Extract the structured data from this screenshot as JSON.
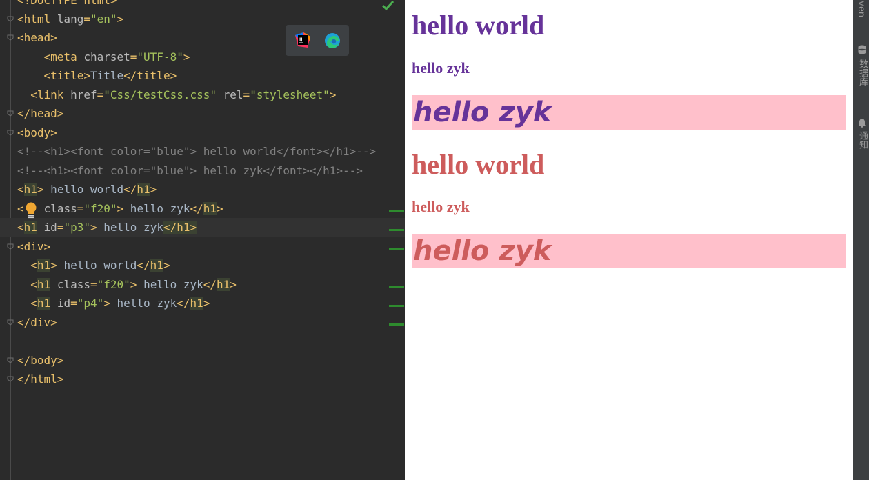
{
  "editor": {
    "lines": [
      [
        [
          "t-tag",
          "<!DOCTYPE html>"
        ]
      ],
      [
        [
          "t-tag",
          "<html "
        ],
        [
          "t-attr",
          "lang"
        ],
        [
          "t-tag",
          "="
        ],
        [
          "t-val",
          "\"en\""
        ],
        [
          "t-tag",
          ">"
        ]
      ],
      [
        [
          "t-tag",
          "<head>"
        ]
      ],
      [
        [
          "t-text",
          "    "
        ],
        [
          "t-tag",
          "<meta "
        ],
        [
          "t-attr",
          "charset"
        ],
        [
          "t-tag",
          "="
        ],
        [
          "t-val",
          "\"UTF-8\""
        ],
        [
          "t-tag",
          ">"
        ]
      ],
      [
        [
          "t-text",
          "    "
        ],
        [
          "t-tag",
          "<title>"
        ],
        [
          "t-text",
          "Title"
        ],
        [
          "t-tag",
          "</title>"
        ]
      ],
      [
        [
          "t-text",
          "  "
        ],
        [
          "t-tag",
          "<link "
        ],
        [
          "t-attr",
          "href"
        ],
        [
          "t-tag",
          "="
        ],
        [
          "t-val",
          "\"Css/testCss.css\""
        ],
        [
          "t-text",
          " "
        ],
        [
          "t-attr",
          "rel"
        ],
        [
          "t-tag",
          "="
        ],
        [
          "t-val",
          "\"stylesheet\""
        ],
        [
          "t-tag",
          ">"
        ]
      ],
      [
        [
          "t-tag",
          "</head>"
        ]
      ],
      [
        [
          "t-tag",
          "<body>"
        ]
      ],
      [
        [
          "t-cmt",
          "<!--<h1><font color=\"blue\"> hello world</font></h1>-->"
        ]
      ],
      [
        [
          "t-cmt",
          "<!--<h1><font color=\"blue\"> hello zyk</font></h1>-->"
        ]
      ],
      [
        [
          "t-tag",
          "<"
        ],
        [
          "t-tag t-hl",
          "h1"
        ],
        [
          "t-tag",
          ">"
        ],
        [
          "t-text",
          " hello world"
        ],
        [
          "t-tag",
          "</"
        ],
        [
          "t-tag t-hl",
          "h1"
        ],
        [
          "t-tag",
          ">"
        ]
      ],
      [
        [
          "t-tag",
          "<"
        ],
        [
          "t-text",
          "   "
        ],
        [
          "t-attr",
          "class"
        ],
        [
          "t-tag",
          "="
        ],
        [
          "t-val",
          "\"f20\""
        ],
        [
          "t-tag",
          ">"
        ],
        [
          "t-text",
          " hello zyk"
        ],
        [
          "t-tag",
          "</"
        ],
        [
          "t-tag t-hl",
          "h1"
        ],
        [
          "t-tag",
          ">"
        ]
      ],
      [
        [
          "t-tag",
          "<"
        ],
        [
          "t-tag t-hl",
          "h1"
        ],
        [
          "t-text",
          " "
        ],
        [
          "t-attr",
          "id"
        ],
        [
          "t-tag",
          "="
        ],
        [
          "t-val",
          "\"p3\""
        ],
        [
          "t-tag",
          ">"
        ],
        [
          "t-text",
          " hello zyk"
        ],
        [
          "t-tag t-hl",
          "</"
        ],
        [
          "t-tag t-hl",
          "h1>"
        ]
      ],
      [
        [
          "t-tag",
          "<div>"
        ]
      ],
      [
        [
          "t-text",
          "  "
        ],
        [
          "t-tag",
          "<"
        ],
        [
          "t-tag t-hl",
          "h1"
        ],
        [
          "t-tag",
          ">"
        ],
        [
          "t-text",
          " hello world"
        ],
        [
          "t-tag",
          "</"
        ],
        [
          "t-tag t-hl",
          "h1"
        ],
        [
          "t-tag",
          ">"
        ]
      ],
      [
        [
          "t-text",
          "  "
        ],
        [
          "t-tag",
          "<"
        ],
        [
          "t-tag t-hl",
          "h1"
        ],
        [
          "t-text",
          " "
        ],
        [
          "t-attr",
          "class"
        ],
        [
          "t-tag",
          "="
        ],
        [
          "t-val",
          "\"f20\""
        ],
        [
          "t-tag",
          ">"
        ],
        [
          "t-text",
          " hello zyk"
        ],
        [
          "t-tag",
          "</"
        ],
        [
          "t-tag t-hl",
          "h1"
        ],
        [
          "t-tag",
          ">"
        ]
      ],
      [
        [
          "t-text",
          "  "
        ],
        [
          "t-tag",
          "<"
        ],
        [
          "t-tag t-hl",
          "h1"
        ],
        [
          "t-text",
          " "
        ],
        [
          "t-attr",
          "id"
        ],
        [
          "t-tag",
          "="
        ],
        [
          "t-val",
          "\"p4\""
        ],
        [
          "t-tag",
          ">"
        ],
        [
          "t-text",
          " hello zyk"
        ],
        [
          "t-tag",
          "</"
        ],
        [
          "t-tag t-hl",
          "h1"
        ],
        [
          "t-tag",
          ">"
        ]
      ],
      [
        [
          "t-tag",
          "</div>"
        ]
      ],
      [],
      [
        [
          "t-tag",
          "</body>"
        ]
      ],
      [
        [
          "t-tag",
          "</html>"
        ]
      ]
    ],
    "status_icon": "check-icon",
    "intention_icon": "bulb-icon"
  },
  "browser_popup": {
    "icons": [
      "intellij-icon",
      "edge-icon"
    ]
  },
  "preview": {
    "h1_plain": "hello world",
    "h1_f20": "hello zyk",
    "h1_p3": "hello zyk",
    "div_h1_plain": "hello world",
    "div_h1_f20": "hello zyk",
    "div_h1_p4": "hello zyk"
  },
  "colors": {
    "outside_div_text": "#663399",
    "inside_div_text": "#cd5c5c",
    "id_background": "#ffc0cb"
  },
  "tool_strip": {
    "maven": "Maven",
    "database": "数据库",
    "notifications": "通知"
  }
}
